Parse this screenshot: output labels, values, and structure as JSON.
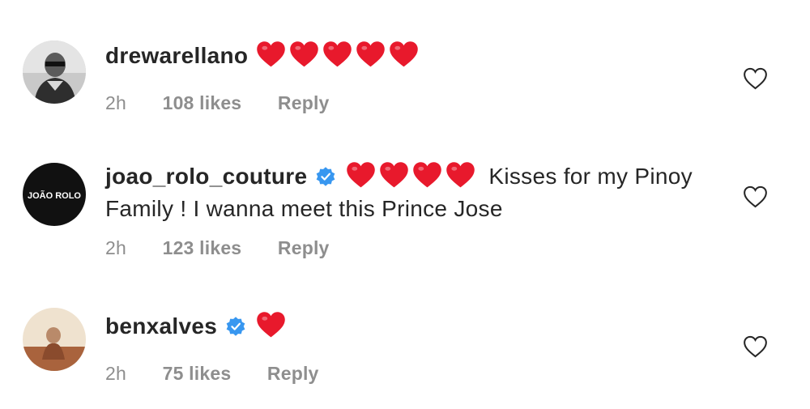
{
  "comments": [
    {
      "username": "drewarellano",
      "verified": false,
      "heart_count": 5,
      "text": "",
      "time": "2h",
      "likes": "108 likes",
      "reply": "Reply"
    },
    {
      "username": "joao_rolo_couture",
      "verified": true,
      "heart_count": 4,
      "text": "Kisses for my Pinoy Family ! I wanna meet this Prince Jose",
      "avatar_text": "JOÃO ROLO",
      "time": "2h",
      "likes": "123 likes",
      "reply": "Reply"
    },
    {
      "username": "benxalves",
      "verified": true,
      "heart_count": 1,
      "text": "",
      "time": "2h",
      "likes": "75 likes",
      "reply": "Reply"
    }
  ],
  "colors": {
    "heart": "#e8192c",
    "verified": "#3897f0",
    "meta": "#8e8e8e",
    "text": "#262626"
  },
  "icons": {
    "heart_emoji": "red-heart-emoji",
    "verified": "verified-badge-icon",
    "like": "heart-outline-icon"
  }
}
